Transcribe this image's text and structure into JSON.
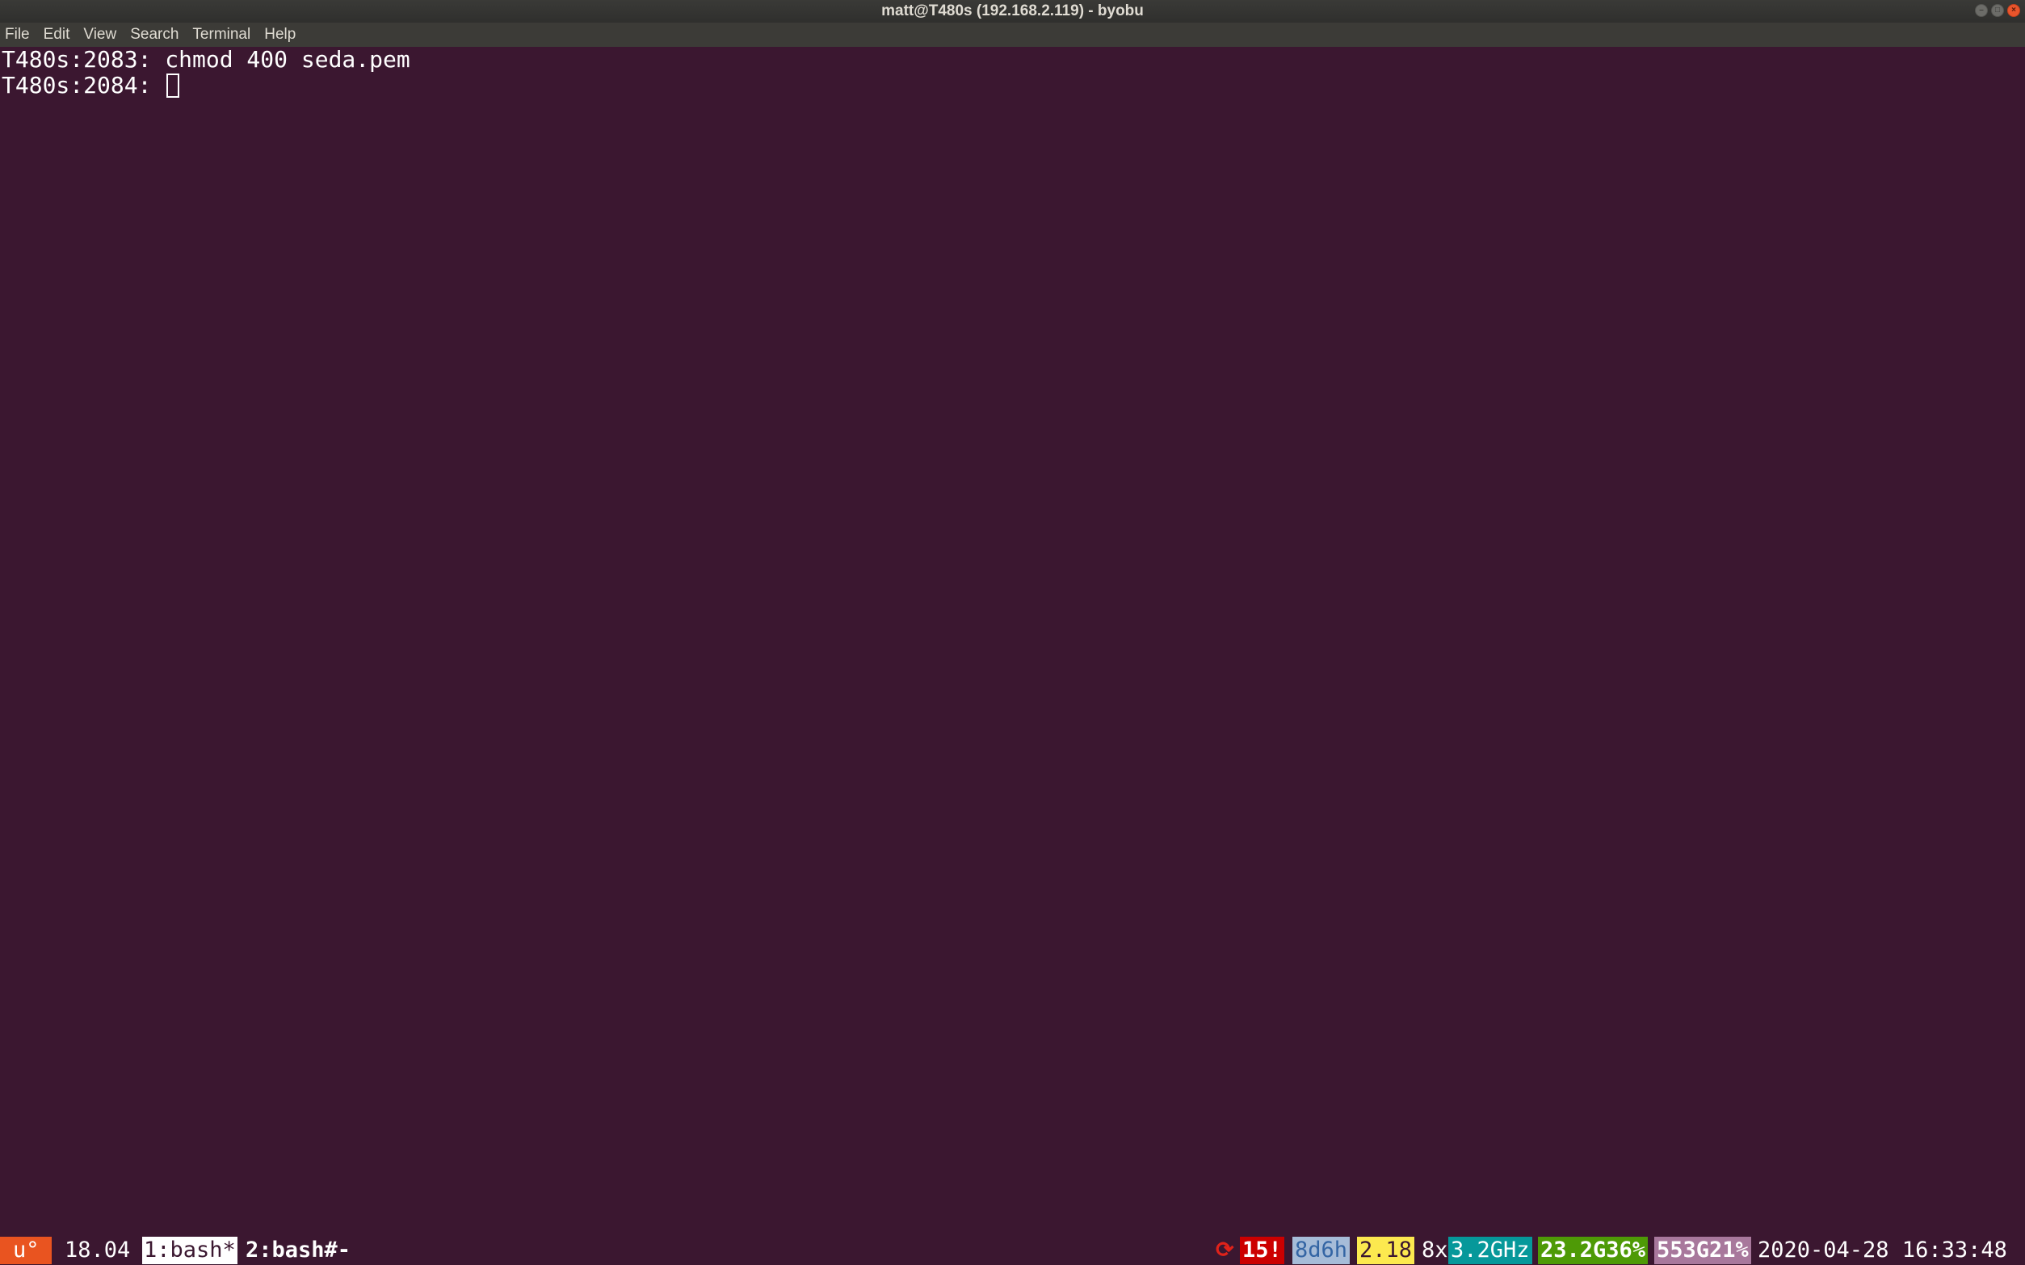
{
  "window": {
    "title": "matt@T480s (192.168.2.119) - byobu",
    "controls": {
      "minimize_icon": "–",
      "maximize_icon": "□",
      "close_icon": "×"
    }
  },
  "menu": {
    "items": [
      "File",
      "Edit",
      "View",
      "Search",
      "Terminal",
      "Help"
    ]
  },
  "terminal": {
    "lines": [
      "T480s:2083: chmod 400 seda.pem",
      "T480s:2084: "
    ],
    "colors": {
      "background": "#3b1730",
      "foreground": "#ffffff"
    }
  },
  "status": {
    "logo": "u°",
    "release": "18.04",
    "windows": [
      "1:bash*",
      "2:bash#-"
    ],
    "reboot_icon": "⟳",
    "updates": "15!",
    "uptime": "8d6h",
    "load": "2.18",
    "cpu_count": "8x",
    "cpu_freq": "3.2GHz",
    "memory": "23.2G36%",
    "disk": "553G21%",
    "datetime": "2020-04-28 16:33:48"
  }
}
